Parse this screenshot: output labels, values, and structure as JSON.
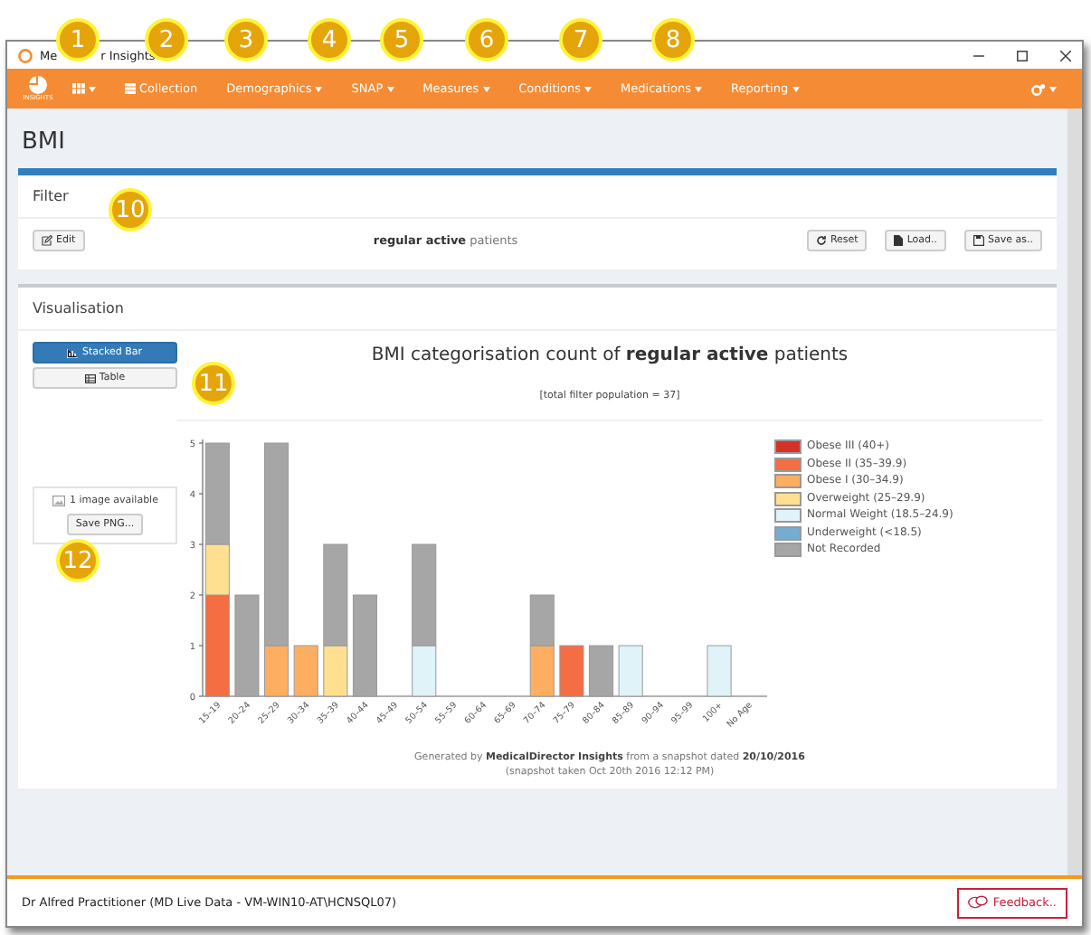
{
  "window": {
    "title_parts": [
      "Me",
      "r Insights"
    ]
  },
  "nav": {
    "logo_label": "INSIGHTS",
    "items": [
      {
        "kind": "grid"
      },
      {
        "kind": "collection",
        "label": "Collection"
      },
      {
        "kind": "menu",
        "label": "Demographics"
      },
      {
        "kind": "menu",
        "label": "SNAP"
      },
      {
        "kind": "menu",
        "label": "Measures"
      },
      {
        "kind": "menu",
        "label": "Conditions"
      },
      {
        "kind": "menu",
        "label": "Medications"
      },
      {
        "kind": "menu",
        "label": "Reporting"
      }
    ]
  },
  "page_title": "BMI",
  "filter": {
    "title": "Filter",
    "edit": "Edit",
    "summary": "**regular active** patients",
    "buttons": [
      {
        "kind": "reset",
        "label": "Reset"
      },
      {
        "kind": "load",
        "label": "Load.."
      },
      {
        "kind": "save",
        "label": "Save as.."
      }
    ]
  },
  "visualisation": {
    "title": "Visualisation",
    "views": [
      {
        "kind": "bar",
        "label": "Stacked Bar",
        "selected": true
      },
      {
        "kind": "table",
        "label": "Table",
        "selected": false
      }
    ],
    "images_available": "1 image available",
    "save_png": "Save PNG...",
    "chart_title": "BMI categorisation count of **regular active** patients",
    "population": "[total filter population = 37]",
    "chart_data": {
      "type": "bar",
      "stacked": true,
      "categories": [
        "15–19",
        "20–24",
        "25–29",
        "30–34",
        "35–39",
        "40–44",
        "45–49",
        "50–54",
        "55–59",
        "60–64",
        "65–69",
        "70–74",
        "75–79",
        "80–84",
        "85–89",
        "90–94",
        "95–99",
        "100+",
        "No Age"
      ],
      "yticks": [
        0,
        1,
        2,
        3,
        4,
        5
      ],
      "ylim": [
        0,
        5
      ],
      "series": [
        {
          "name": "Obese III (40+)",
          "color": "#d73027",
          "values": [
            0,
            0,
            0,
            0,
            0,
            0,
            0,
            0,
            0,
            0,
            0,
            0,
            0,
            0,
            0,
            0,
            0,
            0,
            0
          ]
        },
        {
          "name": "Obese II (35–39.9)",
          "color": "#f46d43",
          "values": [
            2,
            0,
            0,
            0,
            0,
            0,
            0,
            0,
            0,
            0,
            0,
            0,
            1,
            0,
            0,
            0,
            0,
            0,
            0
          ]
        },
        {
          "name": "Obese I (30–34.9)",
          "color": "#fdae61",
          "values": [
            0,
            0,
            1,
            1,
            0,
            0,
            0,
            0,
            0,
            0,
            0,
            1,
            0,
            0,
            0,
            0,
            0,
            0,
            0
          ]
        },
        {
          "name": "Overweight (25–29.9)",
          "color": "#fee090",
          "values": [
            1,
            0,
            0,
            0,
            1,
            0,
            0,
            0,
            0,
            0,
            0,
            0,
            0,
            0,
            0,
            0,
            0,
            0,
            0
          ]
        },
        {
          "name": "Normal Weight (18.5–24.9)",
          "color": "#e0f3f8",
          "values": [
            0,
            0,
            0,
            0,
            0,
            0,
            0,
            1,
            0,
            0,
            0,
            0,
            0,
            0,
            1,
            0,
            0,
            1,
            0
          ]
        },
        {
          "name": "Underweight (<18.5)",
          "color": "#74add1",
          "values": [
            0,
            0,
            0,
            0,
            0,
            0,
            0,
            0,
            0,
            0,
            0,
            0,
            0,
            0,
            0,
            0,
            0,
            0,
            0
          ]
        },
        {
          "name": "Not Recorded",
          "color": "#a6a6a6",
          "values": [
            2,
            2,
            4,
            0,
            2,
            2,
            0,
            2,
            0,
            0,
            0,
            1,
            0,
            1,
            0,
            0,
            0,
            0,
            0
          ]
        }
      ]
    },
    "generated": "Generated by **MedicalDirector Insights** from a snapshot dated **20/10/2016**",
    "snapshot": "(snapshot taken Oct 20th 2016 12:12 PM)"
  },
  "status_bar": {
    "user": "Dr Alfred Practitioner (MD Live Data - VM-WIN10-AT\\HCNSQL07)",
    "feedback": "Feedback.."
  },
  "callouts": [
    "1",
    "2",
    "3",
    "4",
    "5",
    "6",
    "7",
    "8",
    "10",
    "11",
    "12"
  ]
}
